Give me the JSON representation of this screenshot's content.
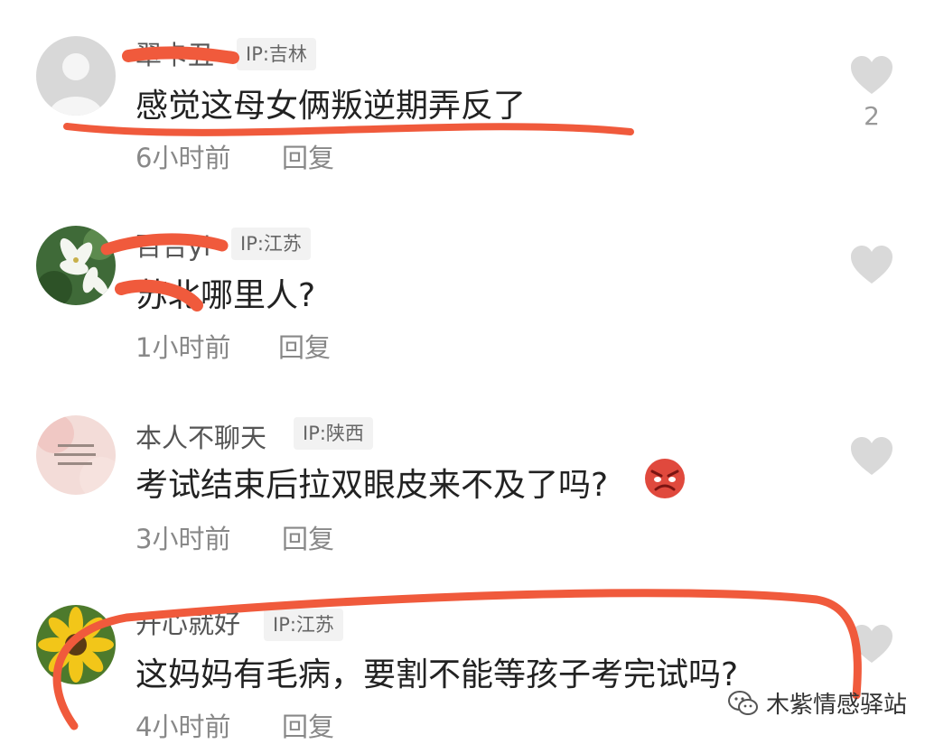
{
  "comments": [
    {
      "username": "翠卡丑",
      "ip": "IP:吉林",
      "text": "感觉这母女俩叛逆期弄反了",
      "time": "6小时前",
      "reply": "回复",
      "likes": "2"
    },
    {
      "username": "百合yi",
      "ip": "IP:江苏",
      "text": "苏北哪里人?",
      "time": "1小时前",
      "reply": "回复",
      "likes": ""
    },
    {
      "username": "本人不聊天",
      "ip": "IP:陕西",
      "text": "考试结束后拉双眼皮来不及了吗?",
      "time": "3小时前",
      "reply": "回复",
      "likes": ""
    },
    {
      "username": "开心就好",
      "ip": "IP:江苏",
      "text": "这妈妈有毛病，要割不能等孩子考完试吗?",
      "time": "4小时前",
      "reply": "回复",
      "likes": ""
    }
  ],
  "watermark": {
    "text": "木紫情感驿站"
  },
  "colors": {
    "annotation": "#f05a3c",
    "heart": "#d9d9d9"
  }
}
